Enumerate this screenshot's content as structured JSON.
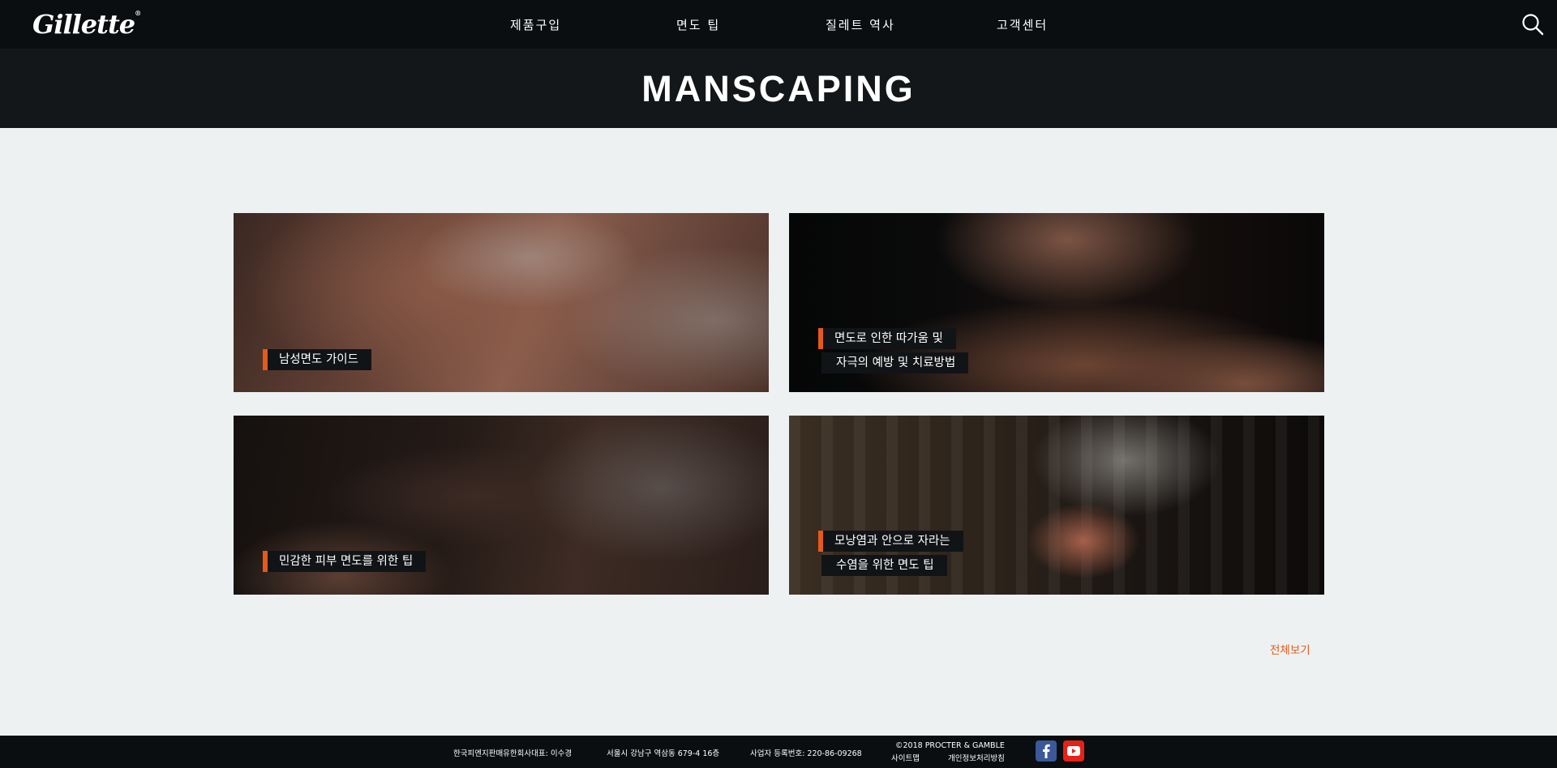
{
  "header": {
    "logo": "Gillette",
    "nav": [
      "제품구입",
      "면도 팁",
      "질레트 역사",
      "고객센터"
    ],
    "search_icon": "search-icon"
  },
  "page": {
    "title": "MANSCAPING"
  },
  "cards": [
    {
      "lines": [
        "남성면도 가이드"
      ]
    },
    {
      "lines": [
        "면도로 인한 따가움 및",
        "자극의 예방 및 치료방법"
      ]
    },
    {
      "lines": [
        "민감한 피부 면도를 위한 팁"
      ]
    },
    {
      "lines": [
        "모낭염과 안으로 자라는",
        "수염을 위한 면도 팁"
      ]
    }
  ],
  "view_all": "전체보기",
  "footer": {
    "company": "한국피엔지판매유한회사대표: 이수경",
    "address": "서울시 강남구 역삼동 679-4 16층",
    "registration": "사업자 등록번호: 220-86-09268",
    "copyright": "©2018 PROCTER & GAMBLE",
    "sitemap": "사이트맵",
    "privacy": "개인정보처리방침",
    "social": [
      "facebook-icon",
      "youtube-icon"
    ]
  },
  "colors": {
    "accent": "#e35a1a",
    "header_bg": "#0a0e10",
    "page_bg": "#edf1f1"
  }
}
